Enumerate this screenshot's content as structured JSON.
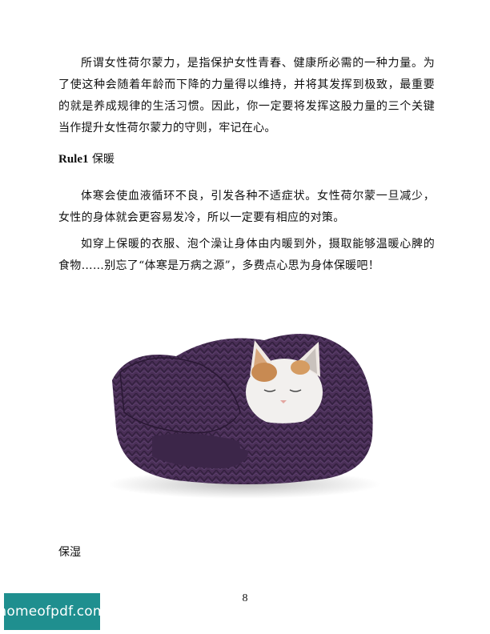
{
  "paragraphs": {
    "intro": "所谓女性荷尔蒙力，是指保护女性青春、健康所必需的一种力量。为了使这种会随着年龄而下降的力量得以维持，并将其发挥到极致，最重要的就是养成规律的生活习惯。因此，你一定要将发挥这股力量的三个关键当作提升女性荷尔蒙力的守则，牢记在心。",
    "rule1_p1": "体寒会使血液循环不良，引发各种不适症状。女性荷尔蒙一旦减少，女性的身体就会更容易发冷，所以一定要有相应的对策。",
    "rule1_p2": "如穿上保暖的衣服、泡个澡让身体由内暖到外，摄取能够温暖心脾的食物……别忘了“体寒是万病之源”，多费点心思为身体保暖吧！"
  },
  "rule1": {
    "label": "Rule1",
    "title": " 保暖"
  },
  "next_section": "保湿",
  "page_number": "8",
  "watermark": "homeofpdf.com",
  "colors": {
    "sweater": "#4a2f57",
    "sweater_dark": "#33203f",
    "watermark_bg": "#1f8f8f"
  }
}
